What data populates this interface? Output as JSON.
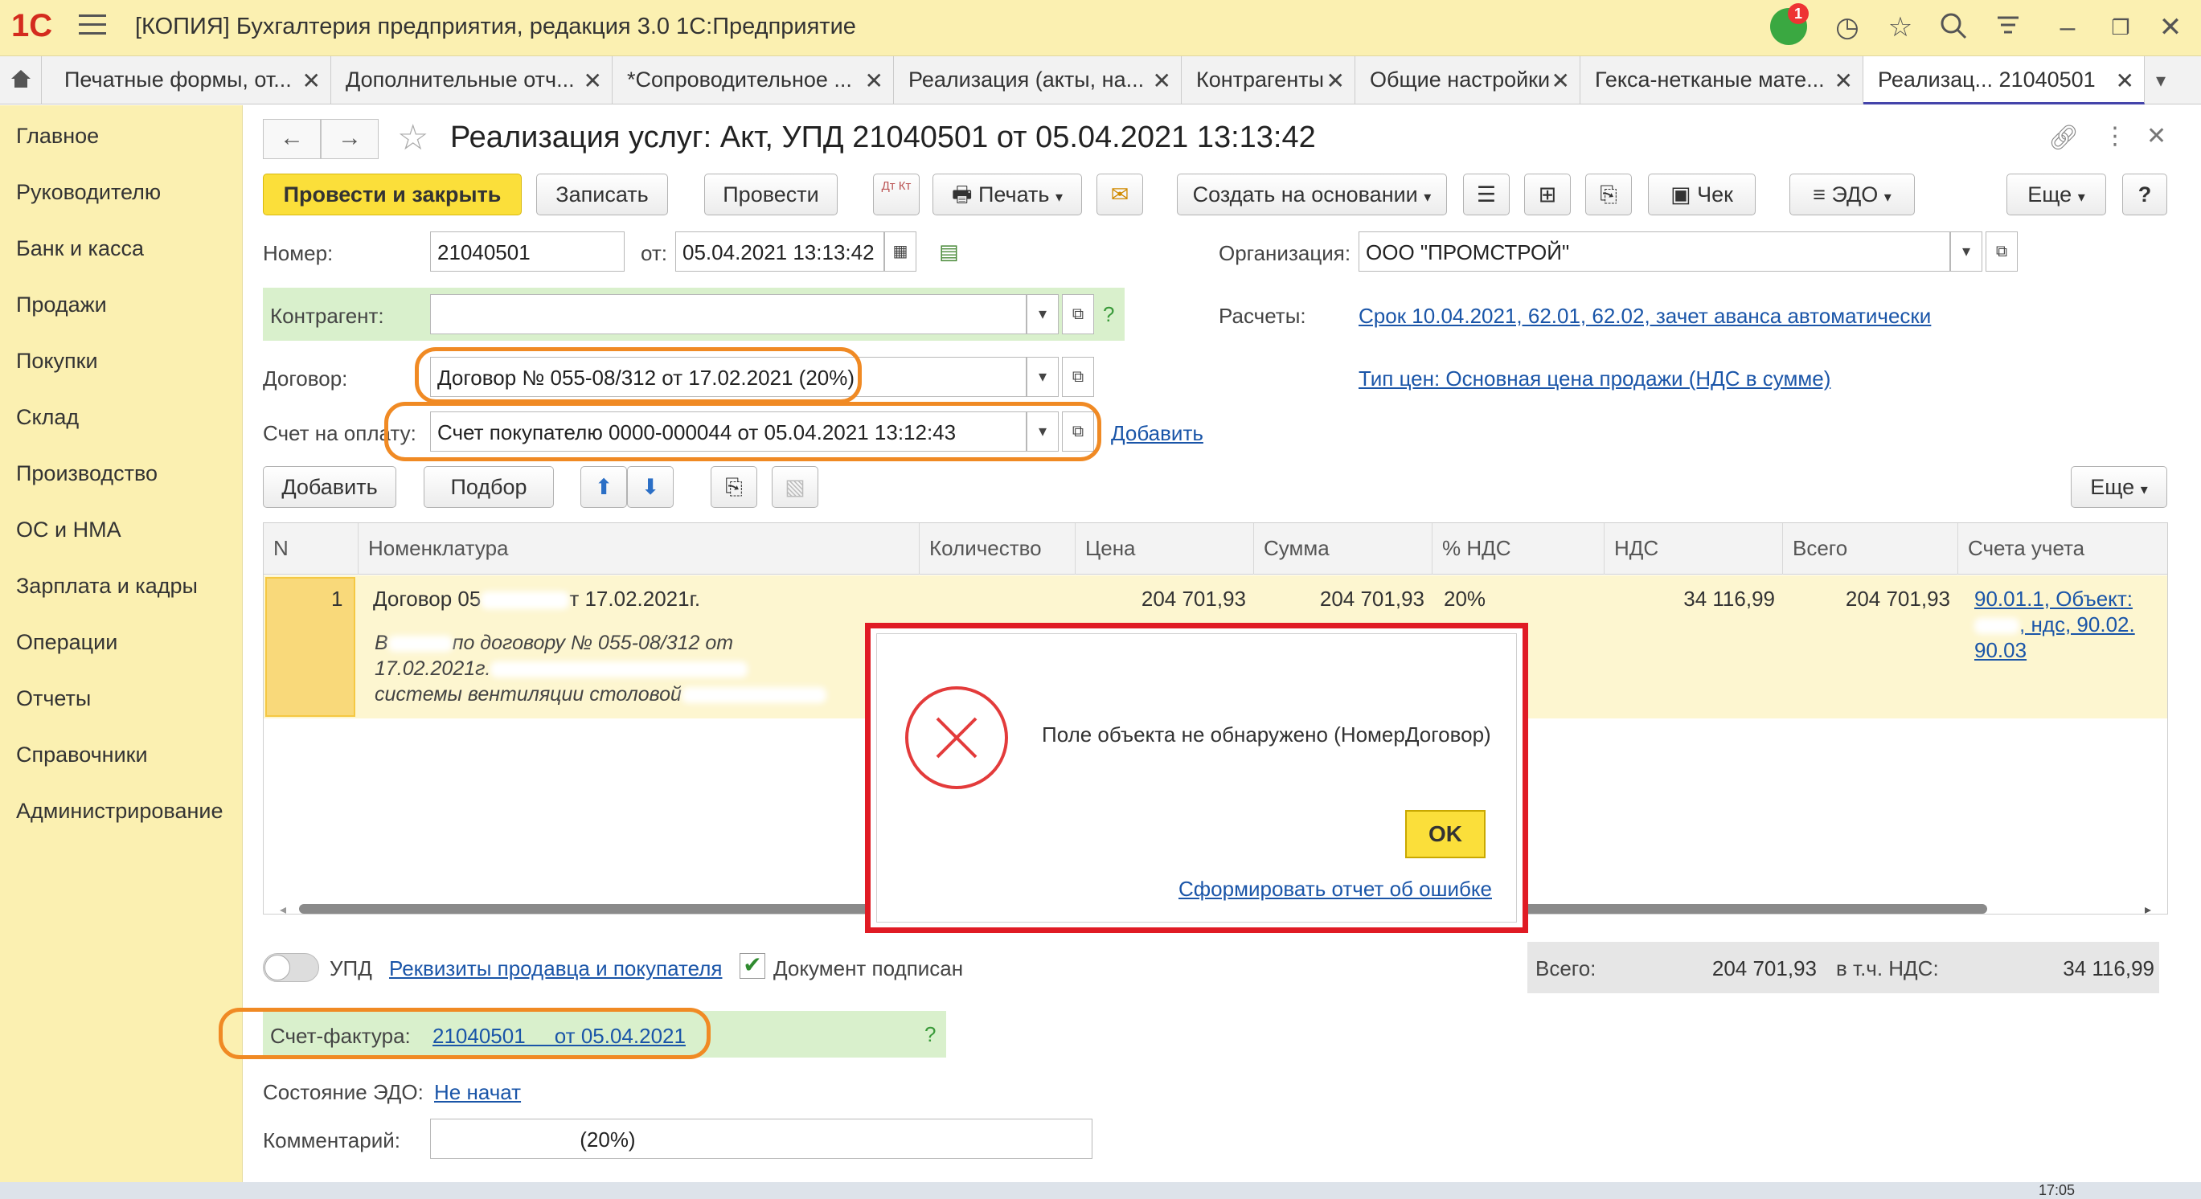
{
  "window": {
    "logo": "1С",
    "title": "[КОПИЯ] Бухгалтерия предприятия, редакция 3.0 1С:Предприятие",
    "notification_count": "1",
    "icons": [
      "history-icon",
      "star-icon",
      "search-icon",
      "settings-icon",
      "minimize-icon",
      "restore-icon",
      "close-icon"
    ]
  },
  "tabs": [
    {
      "label": "Печатные формы, от..."
    },
    {
      "label": "Дополнительные отч..."
    },
    {
      "label": "*Сопроводительное ..."
    },
    {
      "label": "Реализация (акты, на..."
    },
    {
      "label": "Контрагенты"
    },
    {
      "label": "Общие настройки"
    },
    {
      "label": "Гекса-нетканые мате..."
    },
    {
      "label": "Реализац... 21040501",
      "active": true
    }
  ],
  "sidebar": {
    "items": [
      {
        "label": "Главное"
      },
      {
        "label": "Руководителю"
      },
      {
        "label": "Банк и касса"
      },
      {
        "label": "Продажи"
      },
      {
        "label": "Покупки"
      },
      {
        "label": "Склад"
      },
      {
        "label": "Производство"
      },
      {
        "label": "ОС и НМА"
      },
      {
        "label": "Зарплата и кадры"
      },
      {
        "label": "Операции"
      },
      {
        "label": "Отчеты"
      },
      {
        "label": "Справочники"
      },
      {
        "label": "Администрирование"
      }
    ]
  },
  "form": {
    "title": "Реализация услуг: Акт, УПД 21040501     от 05.04.2021 13:13:42",
    "toolbar": {
      "post_close": "Провести и закрыть",
      "save": "Записать",
      "post": "Провести",
      "dt_kt": "Дт Кт",
      "print": "Печать",
      "create_based": "Создать на основании",
      "check": "Чек",
      "edo": "ЭДО",
      "more": "Еще",
      "help": "?"
    },
    "number_label": "Номер:",
    "number_value": "21040501",
    "date_label": "от:",
    "date_value": "05.04.2021 13:13:42",
    "org_label": "Организация:",
    "org_value": "ООО \"ПРОМСТРОЙ\"",
    "contractor_label": "Контрагент:",
    "contractor_help": "?",
    "settlements_label": "Расчеты:",
    "settlements_link": "Срок 10.04.2021, 62.01, 62.02, зачет аванса автоматически",
    "contract_label": "Договор:",
    "contract_value": "Договор № 055-08/312 от 17.02.2021 (20%)",
    "price_type_link": "Тип цен: Основная цена продажи (НДС в сумме)",
    "invoice_label": "Счет на оплату:",
    "invoice_value": "Счет покупателю 0000-000044 от 05.04.2021 13:12:43",
    "invoice_add": "Добавить",
    "table_toolbar": {
      "add": "Добавить",
      "pick": "Подбор",
      "more": "Еще"
    }
  },
  "table": {
    "headers": [
      "N",
      "Номенклатура",
      "Количество",
      "Цена",
      "Сумма",
      "% НДС",
      "НДС",
      "Всего",
      "Счета учета"
    ],
    "rows": [
      {
        "n": "1",
        "name": "Договор 05",
        "name_tail": "т 17.02.2021г.",
        "desc_line1": "В",
        "desc_line1_tail": "по договору № 055-08/312 от",
        "desc_line2": "17.02.2021г.",
        "desc_line3": "системы вентиляции столовой",
        "price": "204 701,93",
        "sum": "204 701,93",
        "vat_rate": "20%",
        "vat": "34 116,99",
        "total": "204 701,93",
        "accounts_line1": "90.01.1, Объект:",
        "accounts_line2": ", ндс, 90.02.",
        "accounts_line3": "90.03"
      }
    ]
  },
  "footer": {
    "upd_label": "УПД",
    "requisites_link": "Реквизиты продавца и покупателя",
    "signed_label": "Документ подписан",
    "total_label": "Всего:",
    "total_value": "204 701,93",
    "vat_label": "в т.ч. НДС:",
    "vat_value": "34 116,99",
    "invoice_label": "Счет-фактура:",
    "invoice_link": "21040501     от 05.04.2021",
    "invoice_help": "?",
    "edo_state_label": "Состояние ЭДО:",
    "edo_state_link": "Не начат",
    "comment_label": "Комментарий:",
    "comment_value": "(20%)"
  },
  "dialog": {
    "message": "Поле объекта не обнаружено (НомерДоговор)",
    "ok": "OK",
    "report_link": "Сформировать отчет об ошибке"
  },
  "taskbar": {
    "time": "17:05"
  },
  "colors": {
    "accent_yellow": "#fbdf3a",
    "sidebar_bg": "#fbf0b1",
    "link_blue": "#1a55a8",
    "error_red": "#e01b24",
    "highlight_orange": "#f08a24",
    "green_band": "#d9f0cc"
  }
}
